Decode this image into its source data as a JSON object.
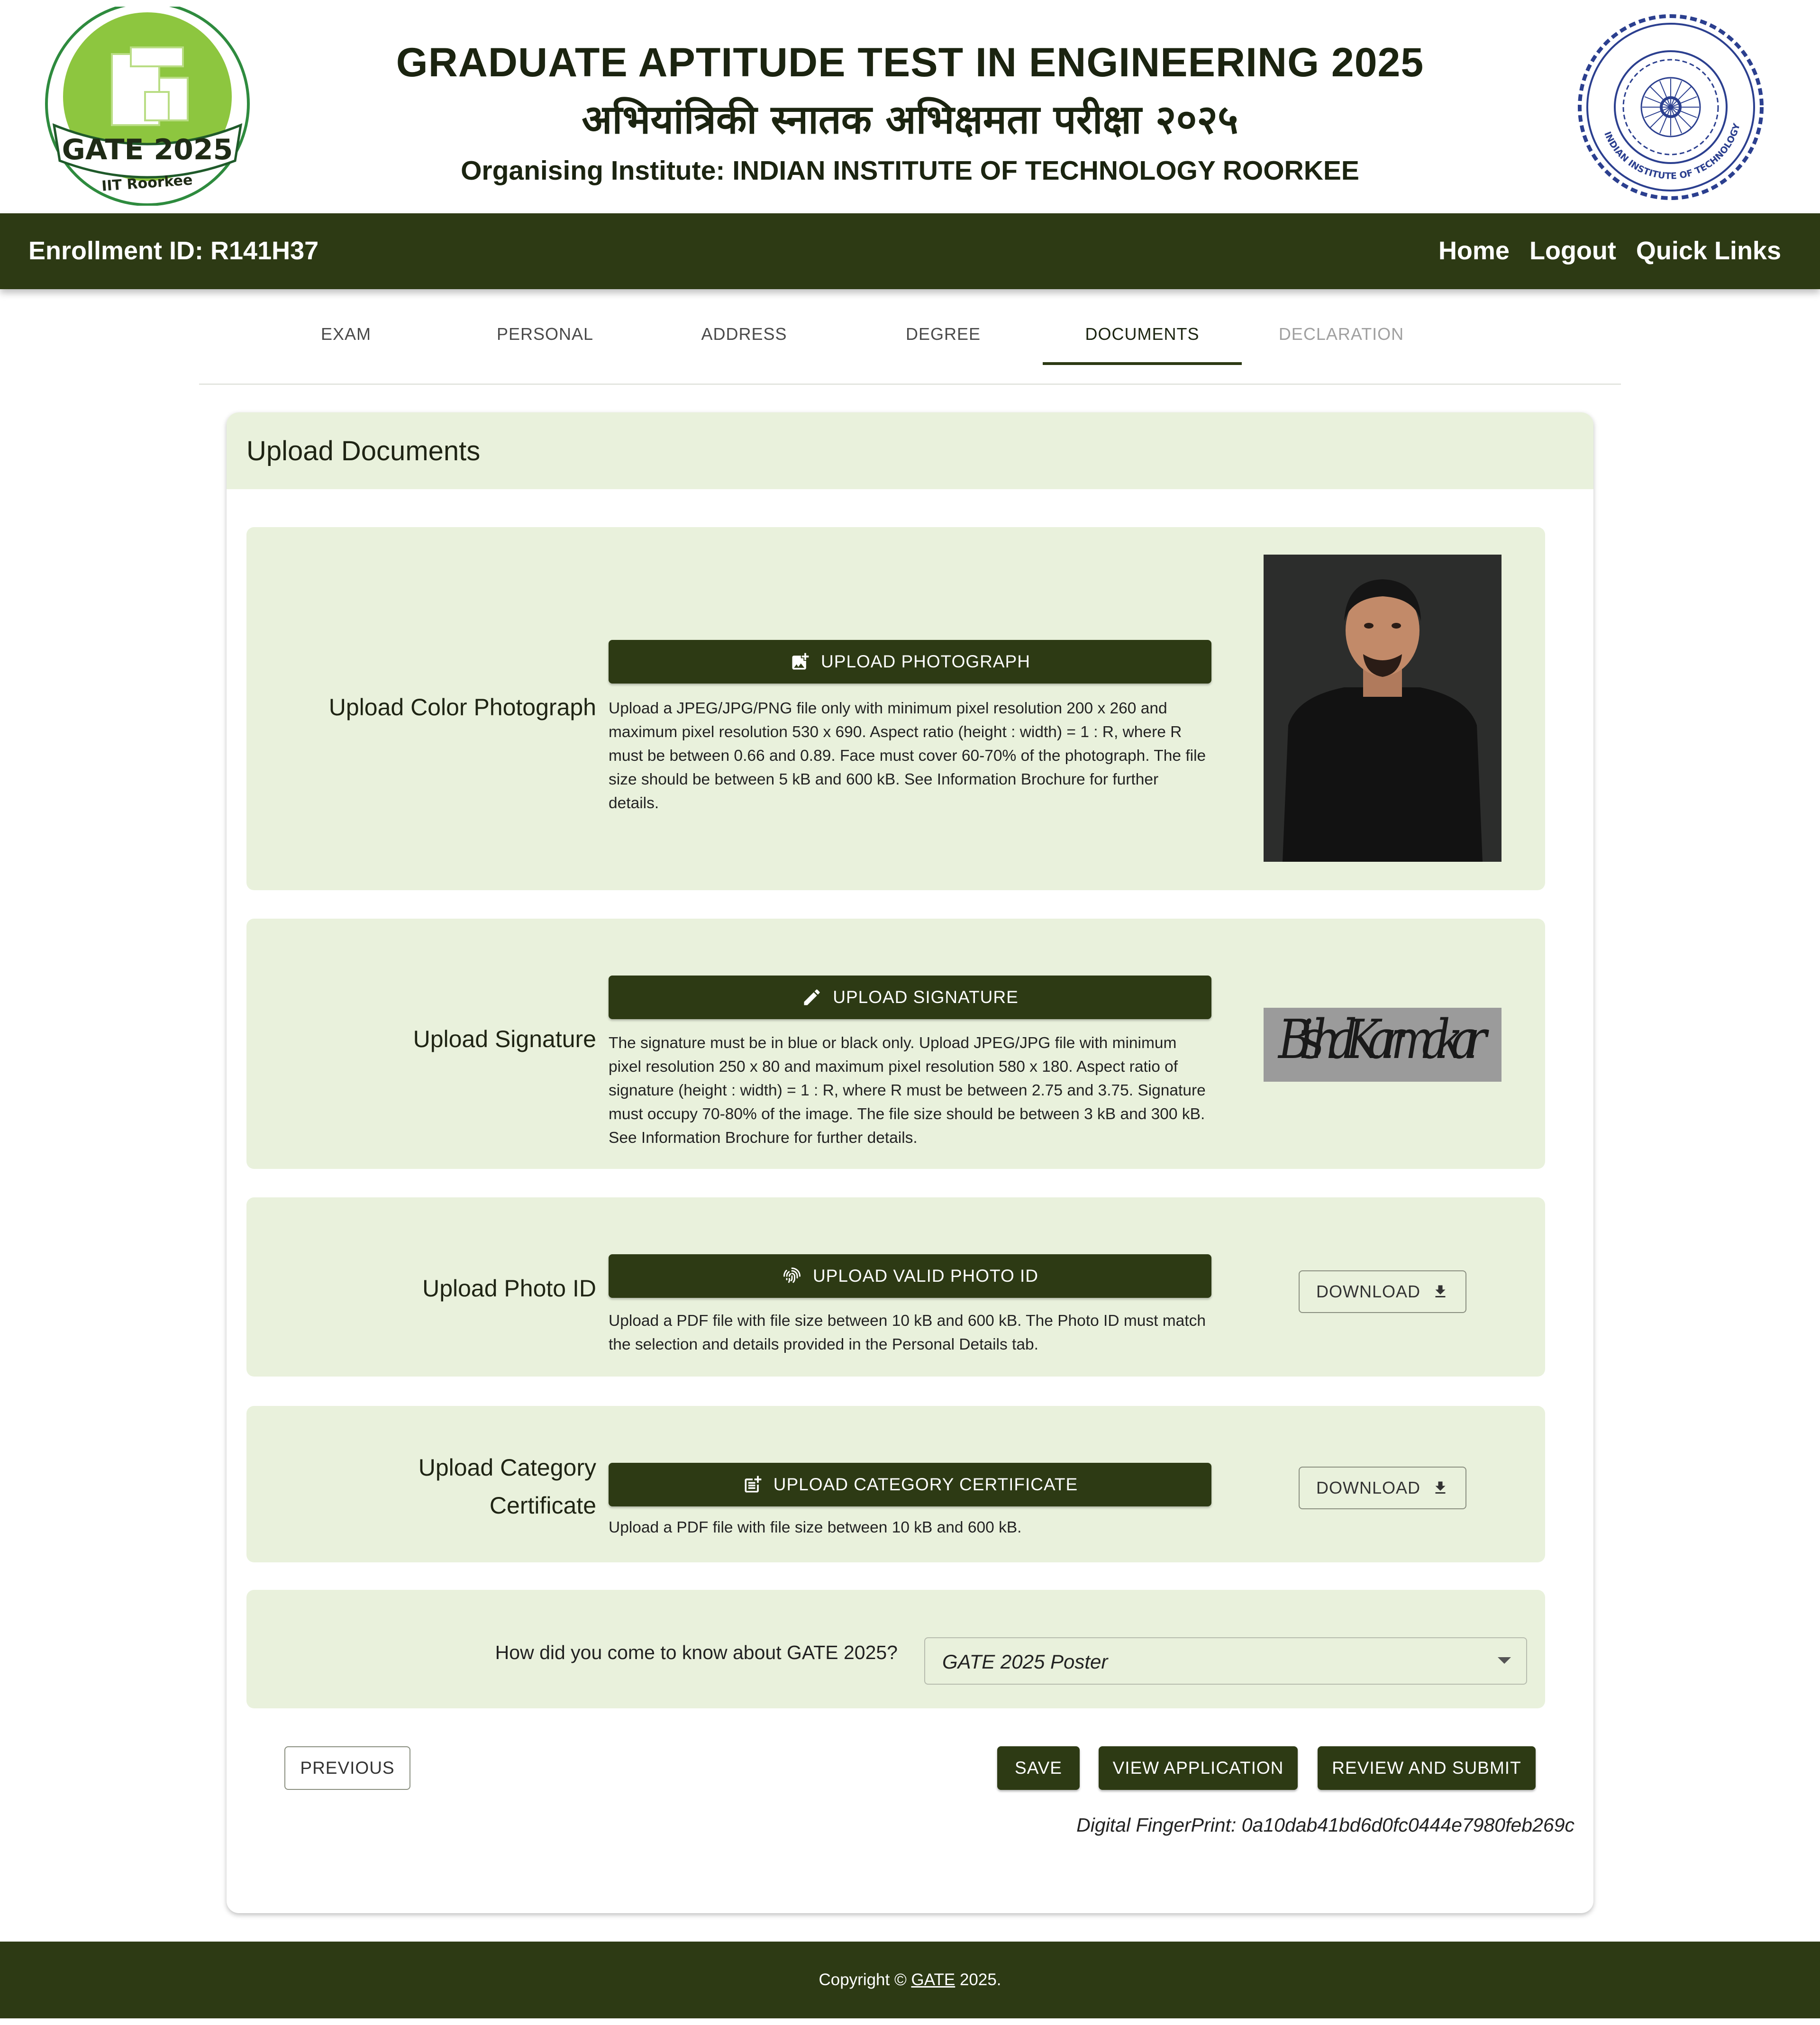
{
  "header": {
    "title_en": "GRADUATE APTITUDE TEST IN ENGINEERING 2025",
    "title_hi": "अभियांत्रिकी स्नातक अभिक्षमता परीक्षा २०२५",
    "organising_institute": "Organising Institute: INDIAN INSTITUTE OF TECHNOLOGY ROORKEE",
    "gate_logo": {
      "line1": "GATE 2025",
      "line2": "IIT Roorkee",
      "icon": "gate-logo"
    },
    "iitr_logo": {
      "text": "भारतीय प्रौद्योगिकी संस्थान रुड़की · INDIAN INSTITUTE OF TECHNOLOGY ROORKEE",
      "icon": "iitr-seal"
    }
  },
  "navbar": {
    "enrollment": "Enrollment ID: R141H37",
    "links": [
      "Home",
      "Logout",
      "Quick Links"
    ]
  },
  "tabs": [
    {
      "label": "EXAM",
      "state": "normal"
    },
    {
      "label": "PERSONAL",
      "state": "normal"
    },
    {
      "label": "ADDRESS",
      "state": "normal"
    },
    {
      "label": "DEGREE",
      "state": "normal"
    },
    {
      "label": "DOCUMENTS",
      "state": "active"
    },
    {
      "label": "DECLARATION",
      "state": "disabled"
    }
  ],
  "card": {
    "title": "Upload Documents",
    "photo": {
      "label": "Upload Color Photograph",
      "button": "UPLOAD PHOTOGRAPH",
      "button_icon": "add-photo-icon",
      "help": "Upload a JPEG/JPG/PNG file only with minimum pixel resolution 200 x 260 and maximum pixel resolution 530 x 690. Aspect ratio (height : width) = 1 : R, where R must be between 0.66 and 0.89. Face must cover 60-70% of the photograph. The file size should be between 5 kB and 600 kB. See Information Brochure for further details."
    },
    "signature": {
      "label": "Upload Signature",
      "button": "UPLOAD SIGNATURE",
      "button_icon": "pencil-icon",
      "help": "The signature must be in blue or black only. Upload JPEG/JPG file with minimum pixel resolution 250 x 80 and maximum pixel resolution 580 x 180. Aspect ratio of signature (height : width) = 1 : R, where R must be between 2.75 and 3.75. Signature must occupy 70-80% of the image. The file size should be between 3 kB and 300 kB. See Information Brochure for further details.",
      "preview_text": "Bishal Karmakar"
    },
    "photo_id": {
      "label": "Upload Photo ID",
      "button": "UPLOAD VALID PHOTO ID",
      "button_icon": "fingerprint-icon",
      "help": "Upload a PDF file with file size between 10 kB and 600 kB. The Photo ID must match the selection and details provided in the Personal Details tab.",
      "download": "DOWNLOAD"
    },
    "category": {
      "label_line1": "Upload Category",
      "label_line2": "Certificate",
      "button": "UPLOAD CATEGORY CERTIFICATE",
      "button_icon": "post-add-icon",
      "help": "Upload a PDF file with file size between 10 kB and 600 kB.",
      "download": "DOWNLOAD"
    },
    "source": {
      "question": "How did you come to know about GATE 2025?",
      "selected": "GATE 2025 Poster"
    },
    "actions": {
      "previous": "PREVIOUS",
      "save": "SAVE",
      "view": "VIEW APPLICATION",
      "review": "REVIEW AND SUBMIT"
    },
    "fingerprint": "Digital FingerPrint: 0a10dab41bd6d0fc0444e7980feb269c"
  },
  "footer": {
    "prefix": "Copyright ©",
    "link": "GATE",
    "suffix": "2025."
  },
  "colors": {
    "primary_dark": "#2d3a14",
    "panel_bg": "#e9f1dc",
    "gate_green": "#8dc63f",
    "seal_blue": "#2b3f8f"
  }
}
